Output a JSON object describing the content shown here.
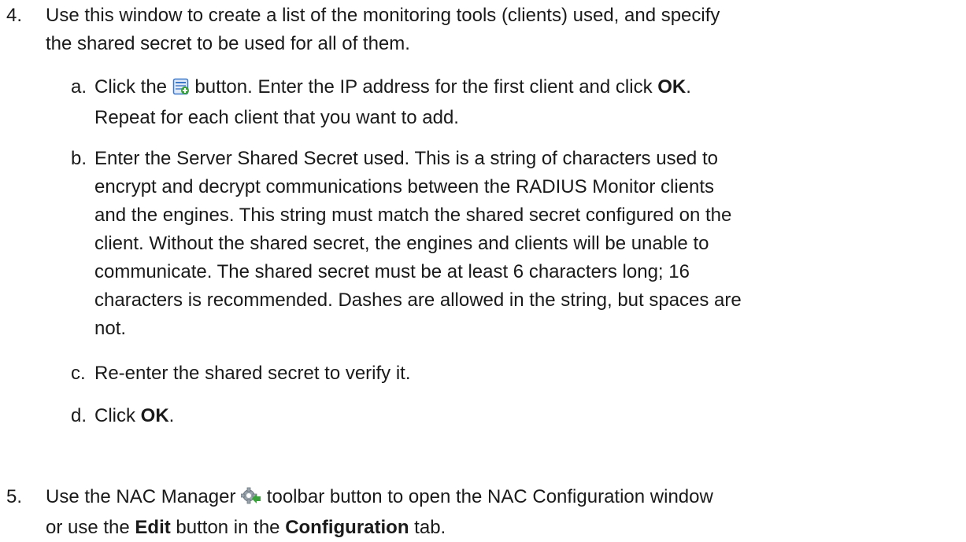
{
  "step4": {
    "number": "4.",
    "lines": [
      "Use this window to create a list of the monitoring tools (clients) used, and specify",
      "the shared secret to be used for all of them."
    ],
    "substeps": {
      "a": {
        "letter": "a.",
        "l1_before": "Click the",
        "l1_after": "button. Enter the IP address for the first client and click",
        "l1_bold": "OK",
        "l1_end": ".",
        "l2": "Repeat for each client that you want to add.",
        "icon": "add-client-icon"
      },
      "b": {
        "letter": "b.",
        "lines": [
          "Enter the Server Shared Secret used. This is a string of characters used to",
          "encrypt and decrypt communications between the RADIUS Monitor clients",
          "and the engines. This string must match the shared secret configured on the",
          "client. Without the shared secret, the engines and clients will be unable to",
          "communicate. The shared secret must be at least 6 characters long; 16",
          "characters is recommended. Dashes are allowed in the string, but spaces are",
          "not."
        ]
      },
      "c": {
        "letter": "c.",
        "text": "Re-enter the shared secret to verify it."
      },
      "d": {
        "letter": "d.",
        "before": "Click",
        "bold": "OK",
        "end": "."
      }
    }
  },
  "step5": {
    "number": "5.",
    "l1_before": "Use the NAC Manager",
    "l1_after": "toolbar button to open the NAC Configuration window",
    "l2_before": "or use the",
    "l2_bold1": "Edit",
    "l2_mid": "button in the",
    "l2_bold2": "Configuration",
    "l2_end": "tab.",
    "icon": "nac-manager-gear-icon"
  },
  "colors": {
    "text": "#1a1a1a",
    "icon_blue": "#3b78c9",
    "icon_green": "#3aa23a"
  }
}
